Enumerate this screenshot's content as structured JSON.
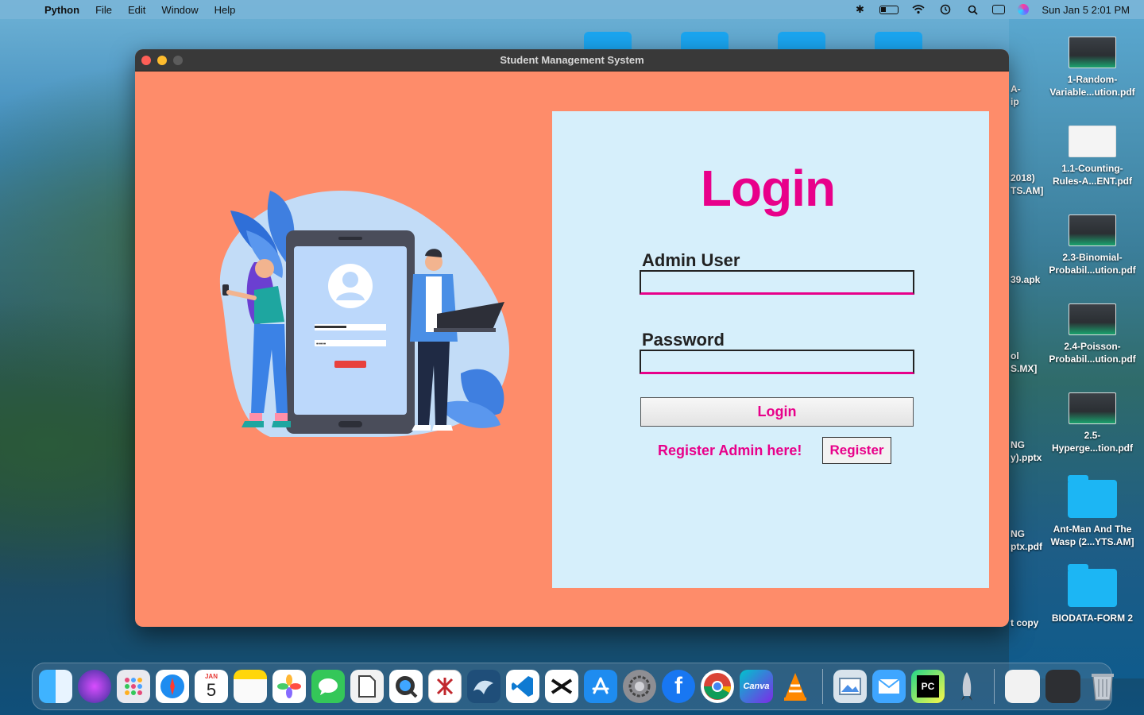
{
  "menubar": {
    "app_name": "Python",
    "menus": [
      "File",
      "Edit",
      "Window",
      "Help"
    ],
    "datetime": "Sun Jan 5  2:01 PM"
  },
  "window": {
    "title": "Student Management System"
  },
  "login": {
    "heading": "Login",
    "admin_user_label": "Admin User",
    "admin_user_value": "",
    "password_label": "Password",
    "password_value": "",
    "login_button": "Login",
    "register_prompt": "Register Admin here!",
    "register_button": "Register"
  },
  "desktop": {
    "items": [
      {
        "label_1": "1-Random-",
        "label_2": "Variable...ution.pdf"
      },
      {
        "label_1": "1.1-Counting-",
        "label_2": "Rules-A...ENT.pdf"
      },
      {
        "label_1": "2.3-Binomial-",
        "label_2": "Probabil...ution.pdf"
      },
      {
        "label_1": "2.4-Poisson-",
        "label_2": "Probabil...ution.pdf"
      },
      {
        "label_1": "2.5-",
        "label_2": "Hyperge...tion.pdf"
      },
      {
        "label_1": "Ant-Man And The",
        "label_2": "Wasp (2...YTS.AM]"
      },
      {
        "label_1": "BIODATA-FORM 2",
        "label_2": ""
      }
    ],
    "partial_labels": [
      "A-",
      "ip",
      "2018)",
      "TS.AM]",
      "39.apk",
      "ol",
      "S.MX]",
      "NG",
      "y).pptx",
      "NG",
      "ptx.pdf",
      "t copy"
    ]
  },
  "dock": {
    "calendar_month": "JAN",
    "calendar_day": "5",
    "canva_label": "Canva",
    "pycharm_label": "PC"
  },
  "colors": {
    "window_bg": "#fe8c6a",
    "panel_bg": "#d6effb",
    "accent_pink": "#e8008a"
  }
}
